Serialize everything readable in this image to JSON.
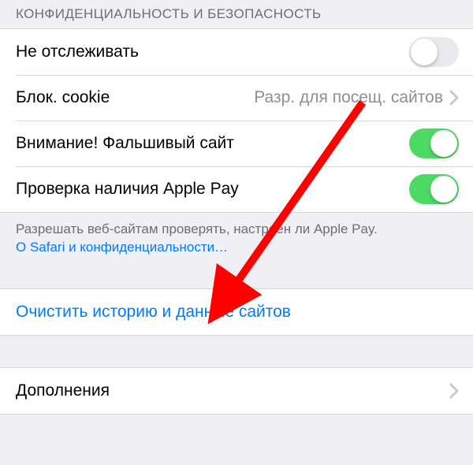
{
  "section_header": "КОНФИДЕНЦИАЛЬНОСТЬ И БЕЗОПАСНОСТЬ",
  "rows": {
    "do_not_track": {
      "label": "Не отслеживать",
      "on": false
    },
    "block_cookies": {
      "label": "Блок. cookie",
      "value": "Разр. для посещ. сайтов"
    },
    "fraud_warning": {
      "label": "Внимание! Фальшивый сайт",
      "on": true
    },
    "apple_pay_check": {
      "label": "Проверка наличия Apple Pay",
      "on": true
    }
  },
  "footer": {
    "text": "Разрешать веб-сайтам проверять, настроен ли Apple Pay.",
    "link": "О Safari и конфиденциальности…"
  },
  "clear_history": "Очистить историю и данные сайтов",
  "extensions": "Дополнения",
  "colors": {
    "link": "#007aff",
    "toggle_on": "#4cd964",
    "arrow": "#ff0000"
  }
}
